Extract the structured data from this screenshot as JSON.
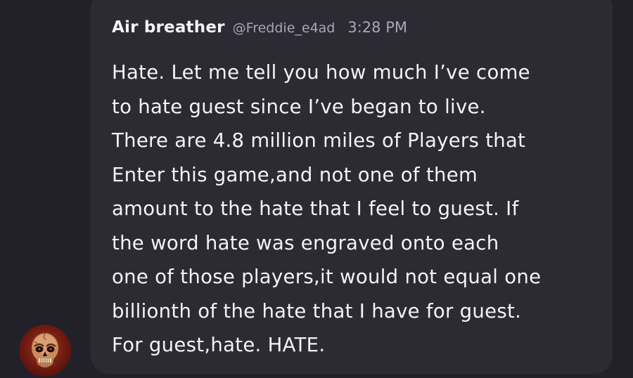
{
  "post": {
    "author": {
      "display_name": "Air breather",
      "handle": "@Freddie_e4ad",
      "avatar_icon": "skull-avatar-icon"
    },
    "time": "3:28 PM",
    "message_lines": [
      "Hate. Let me tell you how much I’ve come",
      "to hate guest since I’ve began to live.",
      "There are 4.8 million miles of Players that",
      "Enter this game,and not one of them",
      "amount to the hate that I feel to guest. If",
      "the word hate was engraved onto each",
      "one of those players,it would not equal one",
      "billionth of the hate that I have for guest.",
      "For guest,hate. HATE."
    ]
  },
  "colors": {
    "background": "#222029",
    "bubble": "#2c2a33",
    "text_primary": "#f4f3f7",
    "text_secondary": "#a9a7b2"
  }
}
